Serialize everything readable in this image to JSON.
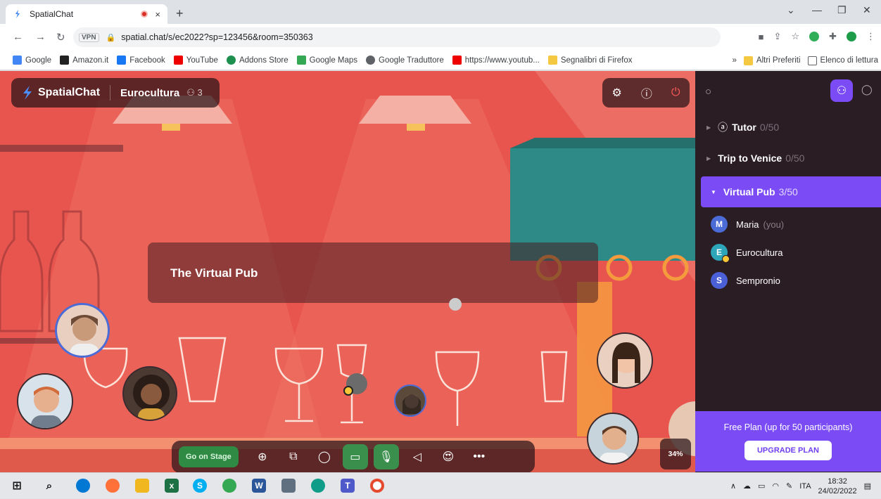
{
  "browser": {
    "tab_title": "SpatialChat",
    "tab_close": "×",
    "new_tab": "+",
    "url": "spatial.chat/s/ec2022?sp=123456&room=350363",
    "vpn_label": "VPN",
    "bookmarks": [
      "Google",
      "Amazon.it",
      "Facebook",
      "YouTube",
      "Addons Store",
      "Google Maps",
      "Google Traduttore",
      "https://www.youtub...",
      "Segnalibri di Firefox"
    ],
    "bookmarks_right": [
      "»",
      "Altri Preferiti",
      "Elenco di lettura"
    ],
    "colors": {
      "rec": "#d93025"
    }
  },
  "app": {
    "brand": "SpatialChat",
    "space_name": "Eurocultura",
    "participant_count": "3",
    "room_sign": "The Virtual Pub",
    "go_on_stage": "Go on Stage",
    "zoom": "34%",
    "icons": [
      "settings-icon",
      "help-icon",
      "power-icon",
      "plus-icon",
      "screen-share-icon",
      "chat-icon",
      "camera-icon",
      "microphone-icon",
      "megaphone-icon",
      "emoji-icon",
      "more-icon"
    ]
  },
  "sidebar": {
    "rooms": [
      {
        "name": "Tutor",
        "cap": "0/50"
      },
      {
        "name": "Trip to Venice",
        "cap": "0/50"
      },
      {
        "name": "Virtual Pub",
        "cap": "3/50"
      }
    ],
    "participants": [
      {
        "initial": "M",
        "name": "Maria",
        "suffix": "(you)",
        "color": "#4b6bd6"
      },
      {
        "initial": "E",
        "name": "Eurocultura",
        "suffix": "",
        "color": "#2ca6b8"
      },
      {
        "initial": "S",
        "name": "Sempronio",
        "suffix": "",
        "color": "#4b5fd6"
      }
    ],
    "plan_text": "Free Plan (up for 50 participants)",
    "upgrade_label": "UPGRADE PLAN",
    "accent": "#7b4cf5"
  },
  "taskbar": {
    "lang": "ITA",
    "time": "18:32",
    "date": "24/02/2022"
  }
}
